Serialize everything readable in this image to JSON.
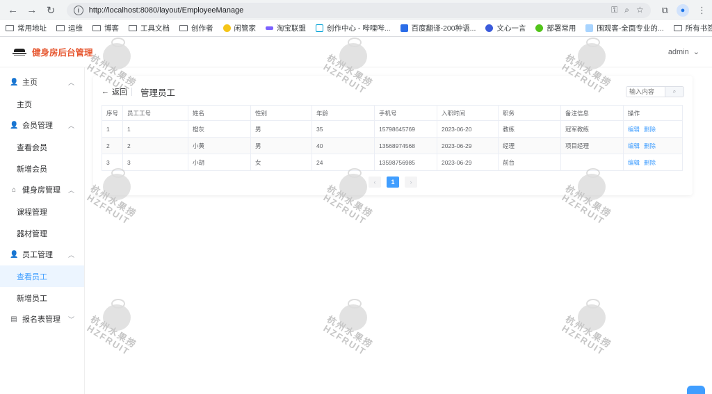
{
  "browser": {
    "url": "http://localhost:8080/layout/EmployeeManage",
    "bookmarks": [
      "常用地址",
      "运维",
      "博客",
      "工具文档",
      "创作者",
      "闲管家",
      "淘宝联盟",
      "创作中心 - 哔哩哔...",
      "百度翻译-200种语...",
      "文心一言",
      "部署常用",
      "围观客-全面专业的..."
    ],
    "bookmarks_right": "所有书签"
  },
  "app": {
    "title": "健身房后台管理",
    "user": "admin"
  },
  "sidebar": {
    "groups": [
      {
        "label": "主页",
        "icon": "user-icon",
        "items": [
          "主页"
        ]
      },
      {
        "label": "会员管理",
        "icon": "user-icon",
        "items": [
          "查看会员",
          "新增会员"
        ]
      },
      {
        "label": "健身房管理",
        "icon": "home-icon",
        "items": [
          "课程管理",
          "器材管理"
        ]
      },
      {
        "label": "员工管理",
        "icon": "user-icon",
        "items": [
          "查看员工",
          "新增员工"
        ]
      },
      {
        "label": "报名表管理",
        "icon": "list-icon",
        "items": []
      }
    ]
  },
  "page": {
    "back": "返回",
    "title": "管理员工",
    "search_placeholder": "输入内容"
  },
  "table": {
    "headers": [
      "序号",
      "员工工号",
      "姓名",
      "性别",
      "年龄",
      "手机号",
      "入职时间",
      "职务",
      "备注信息",
      "操作"
    ],
    "rows": [
      [
        "1",
        "1",
        "橙灰",
        "男",
        "35",
        "15798645769",
        "2023-06-20",
        "教练",
        "冠军教练"
      ],
      [
        "2",
        "2",
        "小黄",
        "男",
        "40",
        "13568974568",
        "2023-06-29",
        "经理",
        "项目经理"
      ],
      [
        "3",
        "3",
        "小胡",
        "女",
        "24",
        "13598756985",
        "2023-06-29",
        "前台",
        ""
      ]
    ],
    "edit": "编辑",
    "delete": "删除"
  },
  "pagination": {
    "current": "1"
  },
  "watermark": {
    "cn": "杭州水果捞",
    "en": "HZFRUIT"
  }
}
